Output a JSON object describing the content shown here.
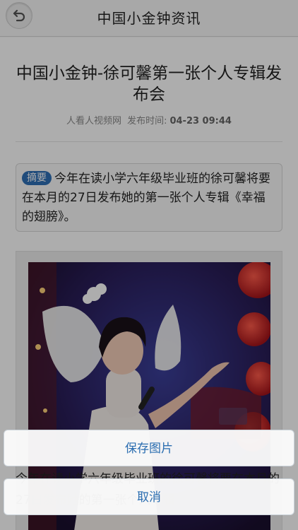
{
  "header": {
    "title": "中国小金钟资讯"
  },
  "article": {
    "title": "中国小金钟-徐可馨第一张个人专辑发布会",
    "source": "人看人视频网",
    "time_label": "发布时间:",
    "time": "04-23 09:44",
    "summary_tag": "摘要",
    "summary": "今年在读小学六年级毕业班的徐可馨将要在本月的27日发布她的第一张个人专辑《幸福的翅膀》。",
    "below_text": "今年在读小学六年级毕业班的徐可馨将要在本月的27日发布她的第一张个人专辑"
  },
  "action_sheet": {
    "save_label": "保存图片",
    "cancel_label": "取消"
  },
  "icons": {
    "back": "back-arrow-icon"
  },
  "colors": {
    "accent": "#2a6db0",
    "tag": "#2f6fb6"
  }
}
